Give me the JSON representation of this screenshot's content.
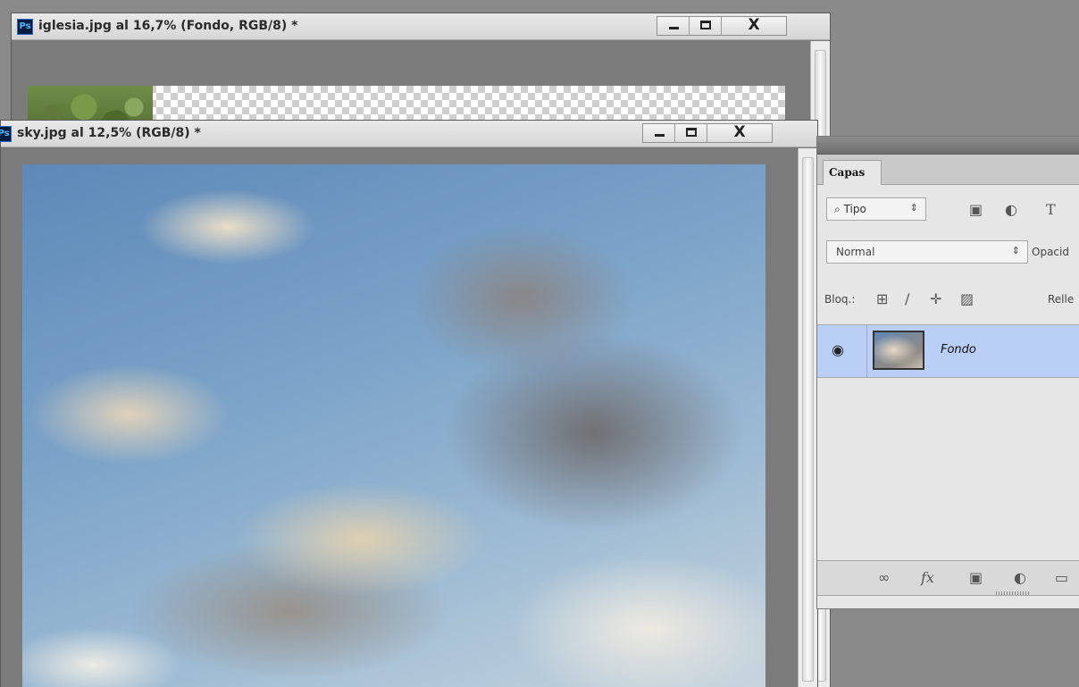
{
  "windows": {
    "iglesia": {
      "badge": "Ps",
      "title": "iglesia.jpg al 16,7% (Fondo, RGB/8) *",
      "close_label": "X"
    },
    "sky": {
      "badge": "Ps",
      "title": "sky.jpg al 12,5% (RGB/8) *",
      "close_label": "X"
    }
  },
  "layers_panel": {
    "tab": "Capas",
    "filter": {
      "label": "Tipo",
      "arrows": "⇕"
    },
    "filter_icons": [
      "image-filter-icon",
      "adjustment-filter-icon",
      "type-filter-icon"
    ],
    "type_icon_glyph": "T",
    "blend_mode": {
      "value": "Normal",
      "arrows": "⇕"
    },
    "opacity_label": "Opacid",
    "lock_label": "Bloq.:",
    "fill_label": "Relle",
    "layers": [
      {
        "name": "Fondo",
        "visible": true,
        "selected": true
      }
    ],
    "footer_icons": [
      "link-icon",
      "fx-icon",
      "mask-icon",
      "adjustment-layer-icon",
      "folder-icon"
    ],
    "fx_label": "fx"
  },
  "colors": {
    "selected_layer": "#b9cff5",
    "ps_badge": "#001d3d",
    "ps_badge_text": "#4cb8ff"
  }
}
